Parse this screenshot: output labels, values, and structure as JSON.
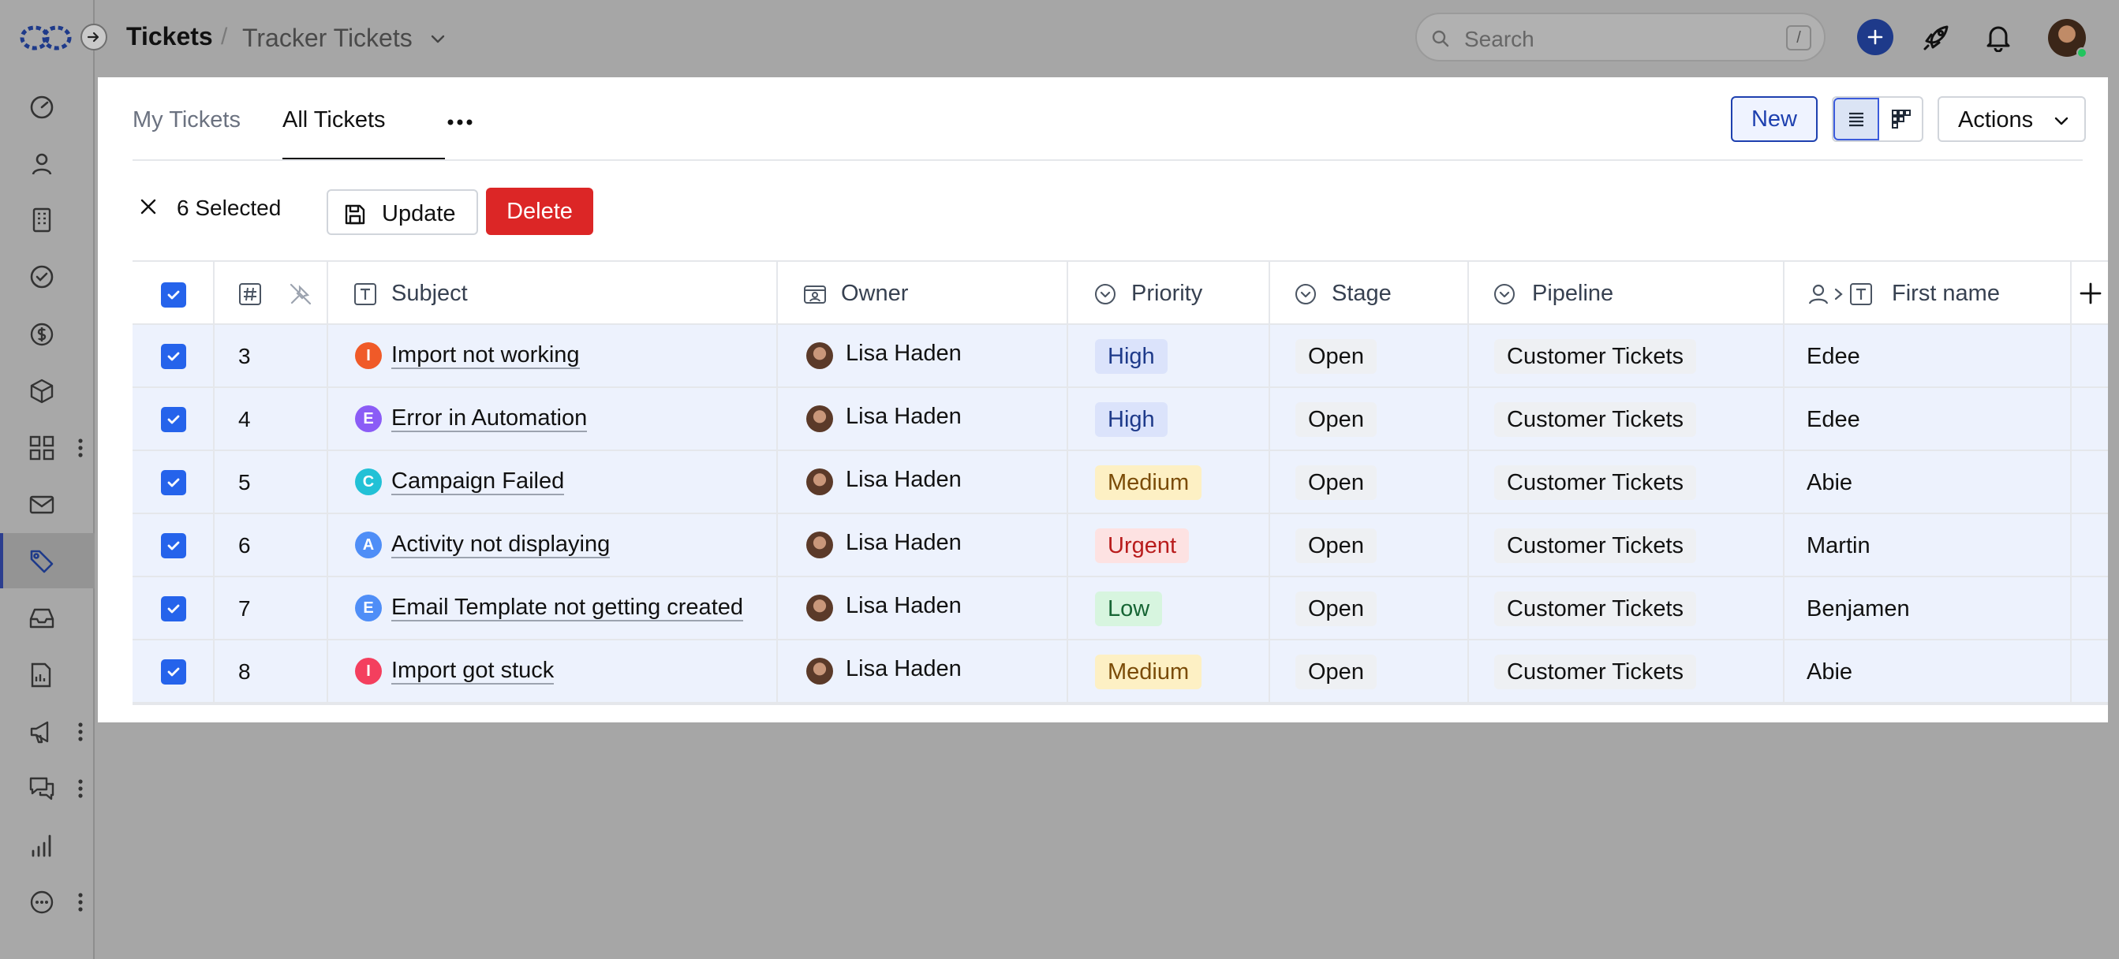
{
  "header": {
    "breadcrumb_root": "Tickets",
    "breadcrumb_separator": "/",
    "breadcrumb_current": "Tracker Tickets",
    "search_placeholder": "Search",
    "search_shortcut": "/"
  },
  "colors": {
    "accent": "#2563eb",
    "brand": "#1e3a8a",
    "delete": "#dc2626",
    "selected_row": "#edf2fd"
  },
  "sidebar": {
    "items": [
      {
        "icon": "dashboard-icon"
      },
      {
        "icon": "contacts-icon"
      },
      {
        "icon": "companies-icon"
      },
      {
        "icon": "tasks-icon"
      },
      {
        "icon": "deals-icon"
      },
      {
        "icon": "products-icon"
      },
      {
        "icon": "apps-icon",
        "has_more": true
      },
      {
        "icon": "mail-icon"
      },
      {
        "icon": "tickets-icon",
        "active": true
      },
      {
        "icon": "inbox-icon"
      },
      {
        "icon": "reports-icon"
      },
      {
        "icon": "campaigns-icon",
        "has_more": true
      },
      {
        "icon": "chat-icon",
        "has_more": true
      },
      {
        "icon": "analytics-icon"
      },
      {
        "icon": "more-icon",
        "has_more": true
      }
    ]
  },
  "view": {
    "tabs": [
      "My Tickets",
      "All Tickets"
    ],
    "active_tab": "All Tickets",
    "new_label": "New",
    "actions_label": "Actions",
    "view_mode": "list"
  },
  "selection": {
    "count_label": "6 Selected",
    "update_label": "Update",
    "delete_label": "Delete"
  },
  "table": {
    "columns": [
      "#",
      "Subject",
      "Owner",
      "Priority",
      "Stage",
      "Pipeline",
      "First name"
    ],
    "rows": [
      {
        "id": "3",
        "badge": "I",
        "badge_color": "#f05a28",
        "subject": "Import not working",
        "owner": "Lisa Haden",
        "priority": "High",
        "stage": "Open",
        "pipeline": "Customer Tickets",
        "first_name": "Edee"
      },
      {
        "id": "4",
        "badge": "E",
        "badge_color": "#8b5cf6",
        "subject": "Error in Automation",
        "owner": "Lisa Haden",
        "priority": "High",
        "stage": "Open",
        "pipeline": "Customer Tickets",
        "first_name": "Edee"
      },
      {
        "id": "5",
        "badge": "C",
        "badge_color": "#22c1d6",
        "subject": "Campaign Failed",
        "owner": "Lisa Haden",
        "priority": "Medium",
        "stage": "Open",
        "pipeline": "Customer Tickets",
        "first_name": "Abie"
      },
      {
        "id": "6",
        "badge": "A",
        "badge_color": "#4f8ef7",
        "subject": "Activity not displaying",
        "owner": "Lisa Haden",
        "priority": "Urgent",
        "stage": "Open",
        "pipeline": "Customer Tickets",
        "first_name": "Martin"
      },
      {
        "id": "7",
        "badge": "E",
        "badge_color": "#4f8ef7",
        "subject": "Email Template not getting created",
        "owner": "Lisa Haden",
        "priority": "Low",
        "stage": "Open",
        "pipeline": "Customer Tickets",
        "first_name": "Benjamen"
      },
      {
        "id": "8",
        "badge": "I",
        "badge_color": "#f43f5e",
        "subject": "Import got stuck",
        "owner": "Lisa Haden",
        "priority": "Medium",
        "stage": "Open",
        "pipeline": "Customer Tickets",
        "first_name": "Abie"
      }
    ]
  }
}
